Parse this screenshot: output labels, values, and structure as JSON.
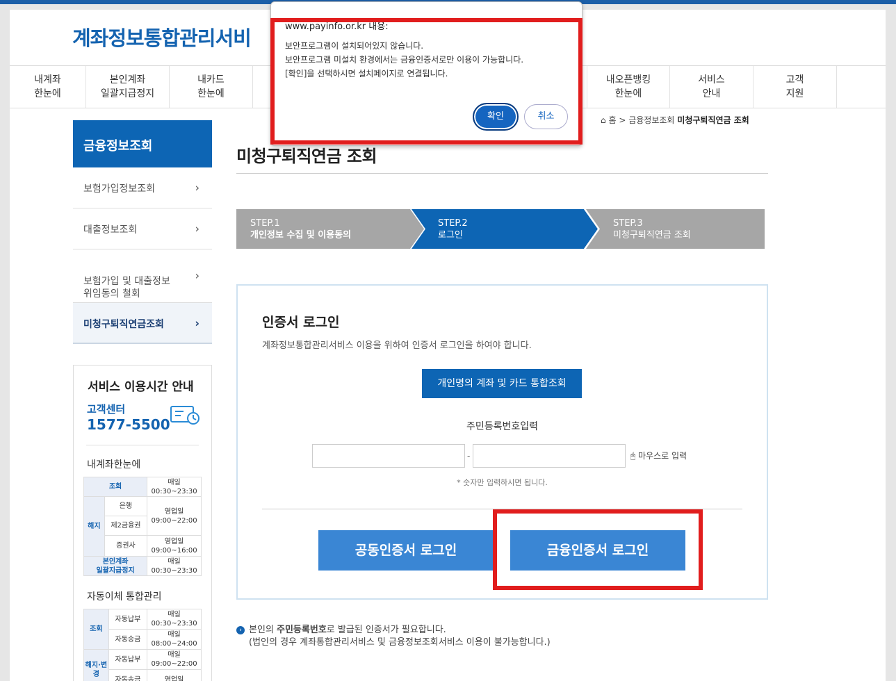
{
  "site": {
    "logo": "계좌정보통합관리서비"
  },
  "gnb": {
    "items": [
      {
        "label": "내계좌\n한눈에"
      },
      {
        "label": "본인계좌\n일괄지급정지"
      },
      {
        "label": "내카드\n한눈에"
      },
      {
        "label": "내오픈뱅킹\n한눈에"
      },
      {
        "label": "서비스\n안내"
      },
      {
        "label": "고객\n지원"
      }
    ]
  },
  "breadcrumb": {
    "home": "홈",
    "sep": ">",
    "parent": "금융정보조회",
    "current": "미청구퇴직연금 조회"
  },
  "lnb": {
    "title": "금융정보조회",
    "items": [
      {
        "label": "보험가입정보조회"
      },
      {
        "label": "대출정보조회"
      },
      {
        "label": "보험가입 및 대출정보\n위임동의 철회"
      },
      {
        "label": "미청구퇴직연금조회"
      }
    ]
  },
  "service": {
    "title": "서비스 이용시간 안내",
    "center": "고객센터",
    "phone": "1577-5500",
    "section1": "내계좌한눈에",
    "section2": "자동이체 통합관리",
    "t1": {
      "view": "조회",
      "daily": "매일",
      "time1": "00:30~23:30",
      "cancel": "해지",
      "bank": "은행",
      "biz": "영업일",
      "time2": "09:00~22:00",
      "fin2": "제2금융권",
      "sec": "증권사",
      "time3": "09:00~16:00",
      "stop": "본인계좌\n일괄지급정지",
      "time4": "00:30~23:30"
    },
    "t2": {
      "view": "조회",
      "pay": "자동납부",
      "daily": "매일",
      "time1": "00:30~23:30",
      "send": "자동송금",
      "time2": "08:00~24:00",
      "change": "해지·변경",
      "time3": "09:00~22:00",
      "biz": "영업일"
    }
  },
  "main": {
    "title": "미청구퇴직연금 조회",
    "steps": [
      {
        "no": "STEP.1",
        "label": "개인정보 수집 및 이용동의"
      },
      {
        "no": "STEP.2",
        "label": "로그인"
      },
      {
        "no": "STEP.3",
        "label": "미청구퇴직연금 조회"
      }
    ],
    "login_title": "인증서 로그인",
    "login_desc": "계좌정보통합관리서비스 이용을 위하여 인증서 로그인을 하여야 합니다.",
    "integrated_button": "개인명의 계좌 및 카드 통합조회",
    "rrn_label": "주민등록번호입력",
    "dash": "-",
    "mouse_input": "마우스로 입력",
    "note": "* 숫자만 입력하시면 됩니다.",
    "joint_cert_button": "공동인증서 로그인",
    "fin_cert_button": "금융인증서 로그인",
    "info_line1_pre": "본인의 ",
    "info_line1_bold": "주민등록번호",
    "info_line1_post": "로 발급된 인증서가 필요합니다.",
    "info_line2": "(법인의 경우 계좌통합관리서비스 및 금융정보조회서비스 이용이 불가능합니다.)"
  },
  "dialog": {
    "origin": "www.payinfo.or.kr 내용:",
    "line1": "보안프로그램이 설치되어있지 않습니다.",
    "line2": "보안프로그램 미설치 환경에서는 금융인증서로만 이용이 가능합니다.",
    "line3": "[확인]을 선택하시면 설치페이지로 연결됩니다.",
    "ok": "확인",
    "cancel": "취소"
  },
  "colors": {
    "primary": "#0d65b4",
    "step_inactive": "#a6a6a6",
    "cert_button": "#3a86d4",
    "highlight": "#e11d1d"
  }
}
